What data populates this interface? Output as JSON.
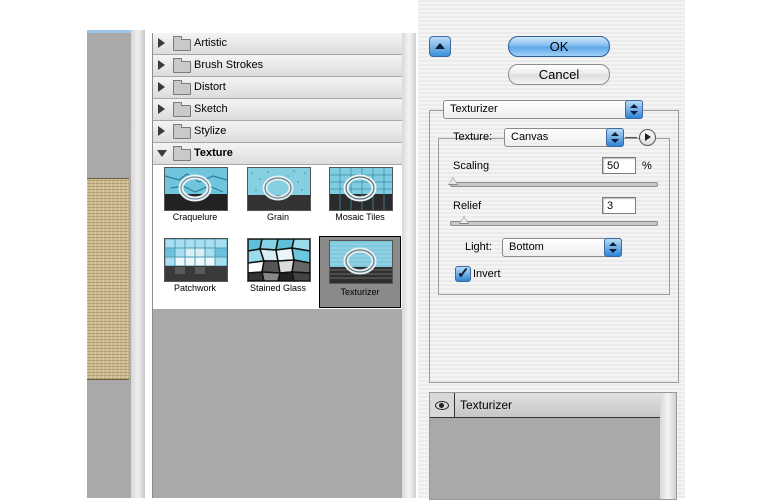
{
  "filter_browser": {
    "categories": [
      {
        "label": "Artistic",
        "state": "collapsed"
      },
      {
        "label": "Brush Strokes",
        "state": "collapsed"
      },
      {
        "label": "Distort",
        "state": "collapsed"
      },
      {
        "label": "Sketch",
        "state": "collapsed"
      },
      {
        "label": "Stylize",
        "state": "collapsed"
      },
      {
        "label": "Texture",
        "state": "expanded"
      }
    ],
    "thumbnails": [
      {
        "label": "Craquelure"
      },
      {
        "label": "Grain"
      },
      {
        "label": "Mosaic Tiles"
      },
      {
        "label": "Patchwork"
      },
      {
        "label": "Stained Glass"
      },
      {
        "label": "Texturizer",
        "selected": true
      }
    ]
  },
  "dialog": {
    "ok_label": "OK",
    "cancel_label": "Cancel",
    "filter_select_value": "Texturizer",
    "texture_label": "Texture:",
    "texture_select_value": "Canvas",
    "scaling_label": "Scaling",
    "scaling_value": "50",
    "scaling_unit": "%",
    "relief_label": "Relief",
    "relief_value": "3",
    "light_label": "Light:",
    "light_select_value": "Bottom",
    "invert_label": "Invert",
    "invert_checked": true
  },
  "layers": {
    "items": [
      {
        "name": "Texturizer",
        "visible": true
      }
    ]
  },
  "colors": {
    "aqua_blue": "#5aa4e7",
    "panel_gray": "#a9a9a9",
    "canvas_texture": "#cdbb91"
  },
  "icons": [
    "folder-icon",
    "disclosure-triangle-icon",
    "eye-icon",
    "collapse-arrow-icon",
    "menu-arrow-icon",
    "checkmark-icon"
  ]
}
